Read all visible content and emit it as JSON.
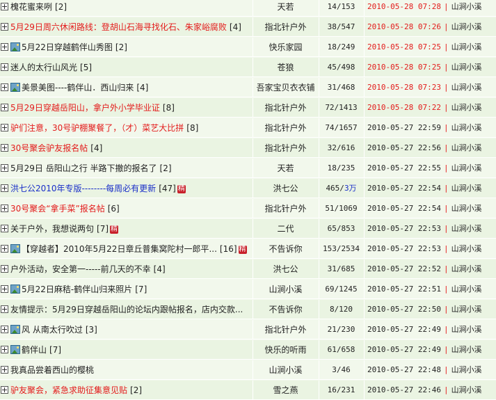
{
  "icons": {
    "expand": "plus-square-icon",
    "image": "image-attachment-icon",
    "badge": "jing-badge"
  },
  "colors": {
    "row_bg": "#F2F8EC",
    "row_alt_bg": "#EAF4E2",
    "red": "#E31B1B",
    "blue": "#1A2FC8"
  },
  "rows": [
    {
      "title": "槐花蜜来咧",
      "count": "[2]",
      "author": "天若",
      "stats": "14/153",
      "time": "2010-05-28 07:28",
      "last": "山涧小溪",
      "color": "black",
      "pic": false,
      "badge": "",
      "time_red": true
    },
    {
      "title": "5月29日周六休闲路线：登胡山石海寻找化石、朱家峪腐败",
      "count": "[4]",
      "author": "指北针户外",
      "stats": "38/547",
      "time": "2010-05-28 07:26",
      "last": "山涧小溪",
      "color": "red",
      "pic": false,
      "badge": "",
      "time_red": true
    },
    {
      "title": "5月22日穿越鹤伴山秀图",
      "count": "[2]",
      "author": "快乐家园",
      "stats": "18/249",
      "time": "2010-05-28 07:25",
      "last": "山涧小溪",
      "color": "black",
      "pic": true,
      "badge": "",
      "time_red": true
    },
    {
      "title": "迷人的太行山风光",
      "count": "[5]",
      "author": "苍狼",
      "stats": "45/498",
      "time": "2010-05-28 07:25",
      "last": "山涧小溪",
      "color": "black",
      "pic": false,
      "badge": "",
      "time_red": true
    },
    {
      "title": "美景美图----鹤伴山．西山归来",
      "count": "[4]",
      "author": "吾家宝贝衣衣铺",
      "stats": "31/468",
      "time": "2010-05-28 07:23",
      "last": "山涧小溪",
      "color": "black",
      "pic": true,
      "badge": "",
      "time_red": true
    },
    {
      "title": "5月29日穿越岳阳山，拿户外小学毕业证",
      "count": "[8]",
      "author": "指北针户外",
      "stats": "72/1413",
      "time": "2010-05-28 07:22",
      "last": "山涧小溪",
      "color": "red",
      "pic": false,
      "badge": "",
      "time_red": true
    },
    {
      "title": "驴们注意，30号驴棚聚餐了，（才）菜艺大比拼",
      "count": "[8]",
      "author": "指北针户外",
      "stats": "74/1657",
      "time": "2010-05-27 22:59",
      "last": "山涧小溪",
      "color": "red",
      "pic": false,
      "badge": "",
      "time_red": false
    },
    {
      "title": "30号聚会驴友报名帖",
      "count": "[4]",
      "author": "指北针户外",
      "stats": "32/616",
      "time": "2010-05-27 22:56",
      "last": "山涧小溪",
      "color": "red",
      "pic": false,
      "badge": "",
      "time_red": false
    },
    {
      "title": "5月29日 岳阳山之行 半路下撤的报名了",
      "count": "[2]",
      "author": "天若",
      "stats": "18/235",
      "time": "2010-05-27 22:55",
      "last": "山涧小溪",
      "color": "black",
      "pic": false,
      "badge": "",
      "time_red": false
    },
    {
      "title": "洪七公2010年专版--------每周必有更新",
      "count": "[47]",
      "author": "洪七公",
      "stats": "465/",
      "stats_extra": "3万",
      "time": "2010-05-27 22:54",
      "last": "山涧小溪",
      "color": "blue",
      "pic": false,
      "badge": "精",
      "time_red": false
    },
    {
      "title": "30号聚会“拿手菜”报名帖",
      "count": "[6]",
      "author": "指北针户外",
      "stats": "51/1069",
      "time": "2010-05-27 22:54",
      "last": "山涧小溪",
      "color": "red",
      "pic": false,
      "badge": "",
      "time_red": false
    },
    {
      "title": "关于户外，我想说两句",
      "count": "[7]",
      "author": "二代",
      "stats": "65/853",
      "time": "2010-05-27 22:53",
      "last": "山涧小溪",
      "color": "black",
      "pic": false,
      "badge": "精",
      "time_red": false
    },
    {
      "title": "【穿越者】2010年5月22日章丘普集窝陀村一郎平...",
      "count": "[16]",
      "author": "不告诉你",
      "stats": "153/2534",
      "time": "2010-05-27 22:53",
      "last": "山涧小溪",
      "color": "black",
      "pic": true,
      "badge": "精",
      "time_red": false
    },
    {
      "title": "户外活动，安全第一-----前几天的不幸",
      "count": "[4]",
      "author": "洪七公",
      "stats": "31/685",
      "time": "2010-05-27 22:52",
      "last": "山涧小溪",
      "color": "black",
      "pic": false,
      "badge": "",
      "time_red": false
    },
    {
      "title": "5月22日麻秸-鹤伴山归来照片",
      "count": "[7]",
      "author": "山涧小溪",
      "stats": "69/1245",
      "time": "2010-05-27 22:51",
      "last": "山涧小溪",
      "color": "black",
      "pic": true,
      "badge": "",
      "time_red": false
    },
    {
      "title": "友情提示：5月29日穿越岳阳山的论坛内跟帖报名，店内交款...",
      "count": "",
      "author": "不告诉你",
      "stats": "8/120",
      "time": "2010-05-27 22:50",
      "last": "山涧小溪",
      "color": "black",
      "pic": false,
      "badge": "",
      "time_red": false
    },
    {
      "title": "风 从南太行吹过",
      "count": "[3]",
      "author": "指北针户外",
      "stats": "21/230",
      "time": "2010-05-27 22:49",
      "last": "山涧小溪",
      "color": "black",
      "pic": true,
      "badge": "",
      "time_red": false
    },
    {
      "title": "鹤伴山",
      "count": "[7]",
      "author": "快乐的听雨",
      "stats": "61/658",
      "time": "2010-05-27 22:49",
      "last": "山涧小溪",
      "color": "black",
      "pic": true,
      "badge": "",
      "time_red": false
    },
    {
      "title": "我真品尝着西山的樱桃",
      "count": "",
      "author": "山涧小溪",
      "stats": "3/46",
      "time": "2010-05-27 22:48",
      "last": "山涧小溪",
      "color": "black",
      "pic": false,
      "badge": "",
      "time_red": false
    },
    {
      "title": "驴友聚会，紧急求助征集意见贴",
      "count": "[2]",
      "author": "雪之燕",
      "stats": "16/231",
      "time": "2010-05-27 22:46",
      "last": "山涧小溪",
      "color": "red",
      "pic": false,
      "badge": "",
      "time_red": false
    }
  ]
}
